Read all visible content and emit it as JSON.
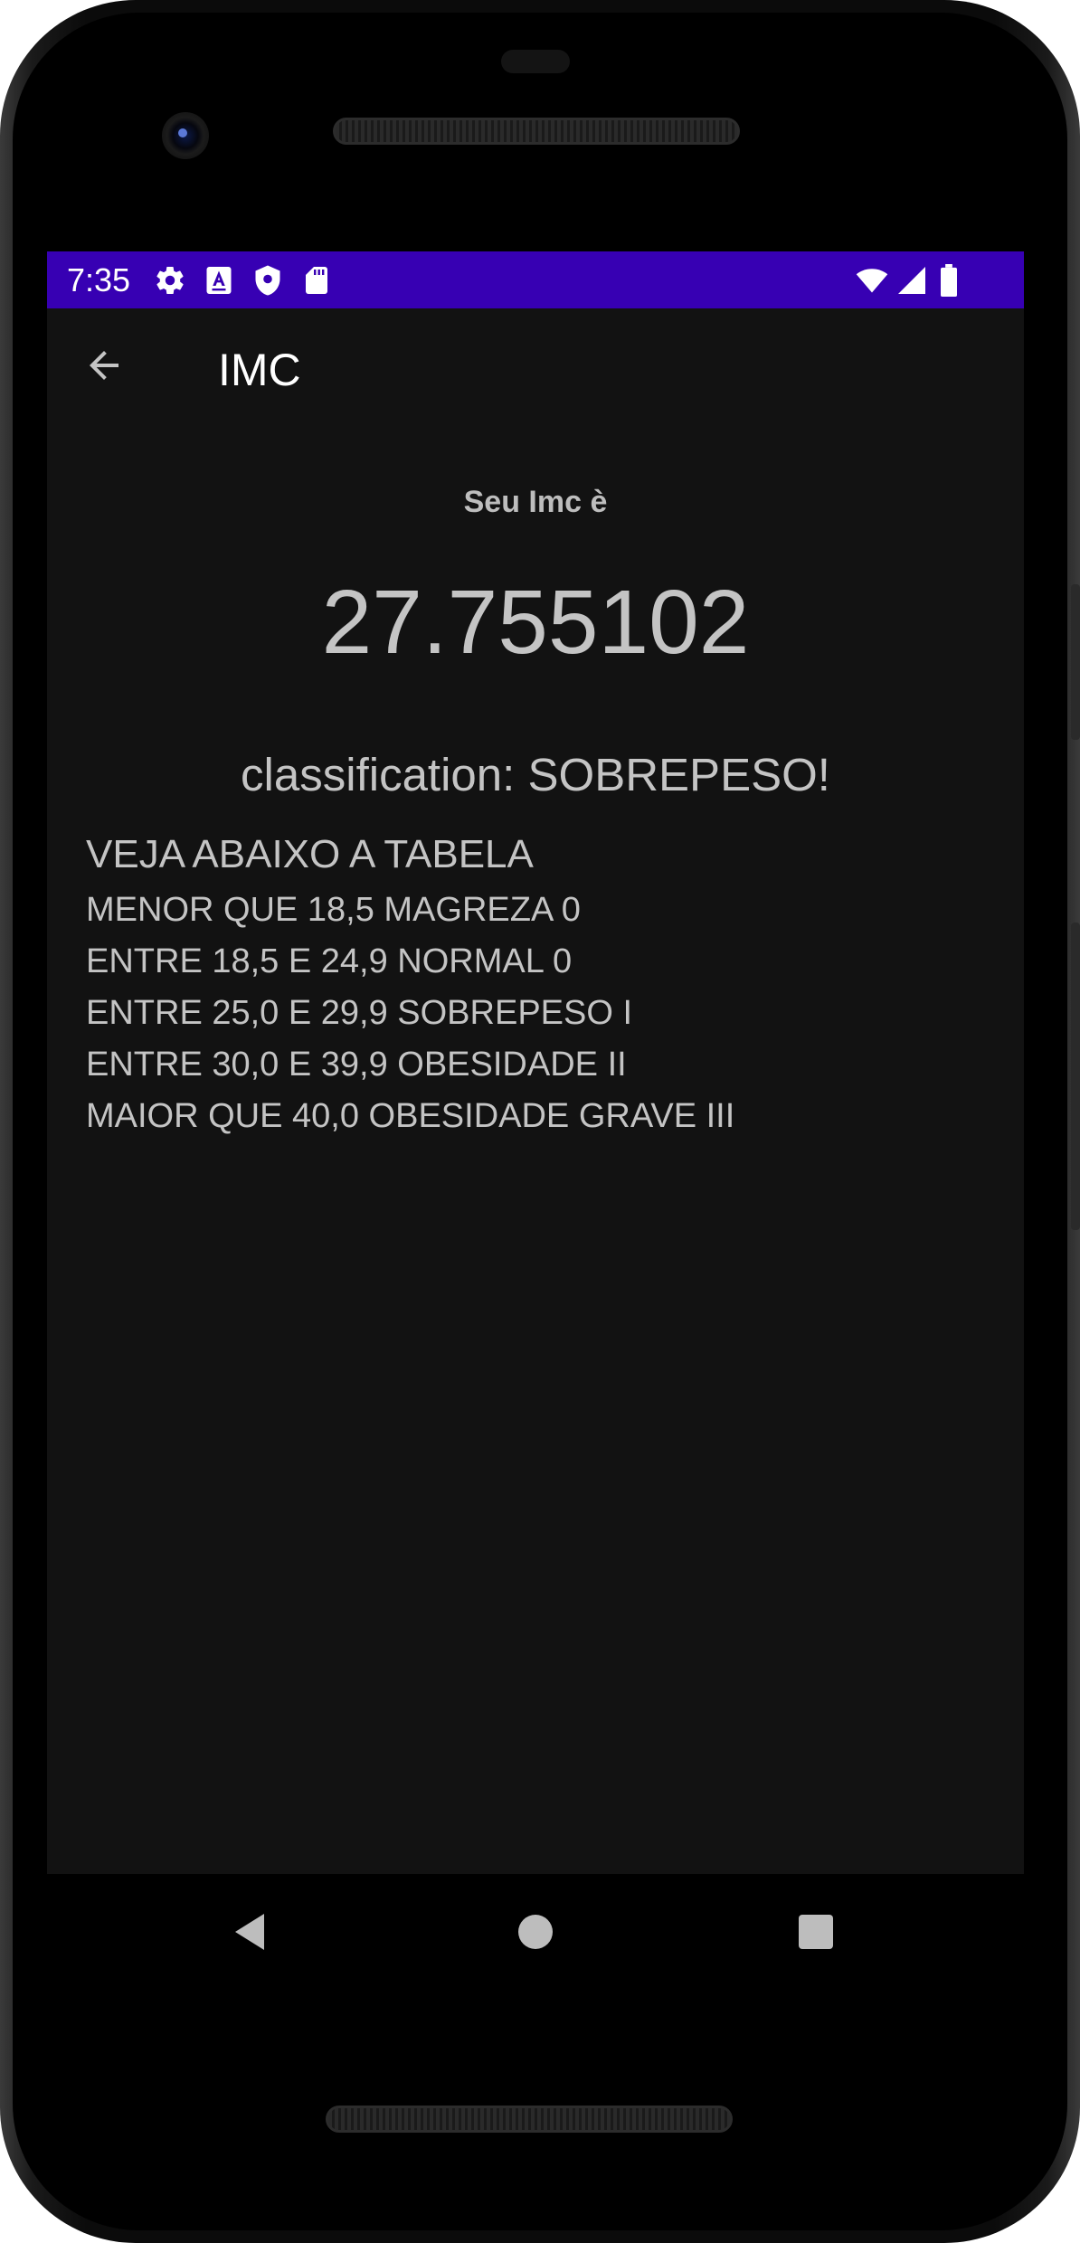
{
  "status_bar": {
    "time": "7:35",
    "left_icons": [
      "settings-gear-icon",
      "text-a-icon",
      "shield-icon",
      "sd-card-icon"
    ],
    "right_icons": [
      "wifi-icon",
      "signal-icon",
      "battery-icon"
    ],
    "color": "#3700b3"
  },
  "app_bar": {
    "back_icon": "arrow-back-icon",
    "title": "IMC"
  },
  "result": {
    "label": "Seu Imc è",
    "value": "27.755102",
    "classification": "classification: SOBREPESO!"
  },
  "table": {
    "heading": "VEJA ABAIXO A TABELA",
    "rows": [
      "MENOR QUE 18,5 MAGREZA 0",
      "ENTRE 18,5 E 24,9 NORMAL 0",
      "ENTRE 25,0 E 29,9 SOBREPESO I",
      "ENTRE 30,0 E 39,9 OBESIDADE II",
      "MAIOR QUE 40,0 OBESIDADE GRAVE III"
    ]
  },
  "nav_bar": {
    "buttons": [
      "nav-back-triangle-icon",
      "nav-home-circle-icon",
      "nav-recents-square-icon"
    ]
  },
  "colors": {
    "background": "#121212",
    "text": "#c4c4c4",
    "status_bar": "#3700b3"
  }
}
